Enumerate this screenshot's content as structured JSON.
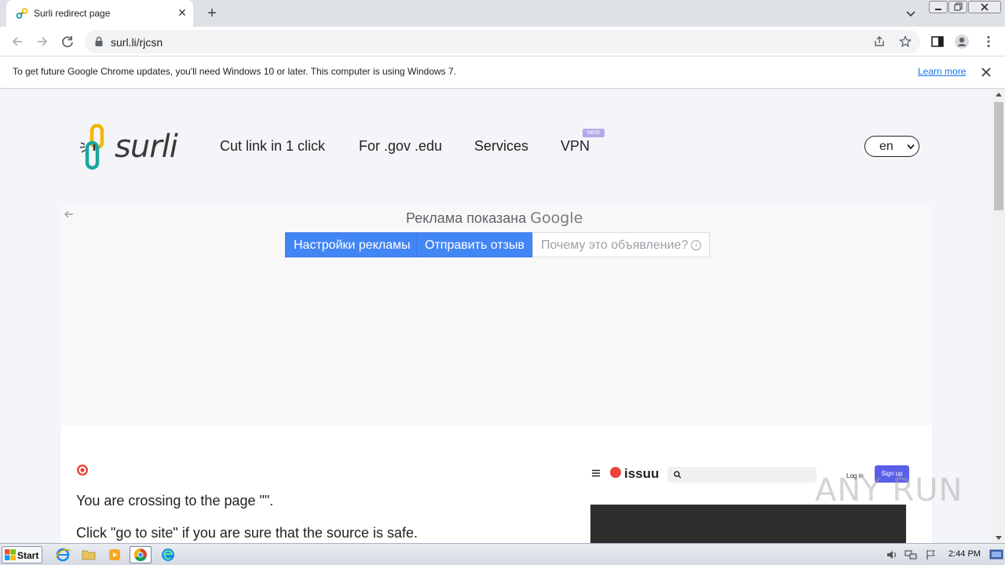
{
  "browser": {
    "tab_title": "Surli redirect page",
    "url": "surl.li/rjcsn",
    "infobar_text": "To get future Google Chrome updates, you'll need Windows 10 or later. This computer is using Windows 7.",
    "infobar_link": "Learn more"
  },
  "site": {
    "logo_text": "surli",
    "nav": [
      "Cut link in 1 click",
      "For .gov .edu",
      "Services",
      "VPN"
    ],
    "vpn_badge": "NEW",
    "language": "en"
  },
  "ad": {
    "shown_by": "Реклама показана",
    "google": "Google",
    "buttons": [
      "Настройки рекламы",
      "Отправить отзыв",
      "Почему это объявление?"
    ]
  },
  "redirect": {
    "crossing_text": "You are crossing to the page \"\".",
    "click_text": "Click \"go to site\" if you are sure that the source is safe."
  },
  "preview": {
    "logo": "issuu",
    "login": "Log in",
    "signup": "Sign up"
  },
  "watermark": "ANY RUN",
  "taskbar": {
    "start": "Start",
    "clock": "2:44 PM"
  },
  "colors": {
    "accent_blue": "#4285f4",
    "link_blue": "#1a73e8",
    "signup_purple": "#5b5fe8",
    "issuu_red": "#e8443a",
    "page_bg": "#f4f5f8"
  },
  "icons": [
    "chain-link-icon",
    "close-icon",
    "plus-icon",
    "chevron-down-icon",
    "back-arrow-icon",
    "forward-arrow-icon",
    "reload-icon",
    "lock-icon",
    "share-icon",
    "star-icon",
    "side-panel-icon",
    "profile-icon",
    "kebab-menu-icon",
    "target-icon",
    "hamburger-icon",
    "search-icon",
    "windows-logo-icon",
    "ie-icon",
    "folder-icon",
    "media-player-icon",
    "chrome-icon",
    "edge-icon",
    "speaker-icon",
    "network-icon",
    "flag-icon",
    "show-desktop-icon"
  ]
}
